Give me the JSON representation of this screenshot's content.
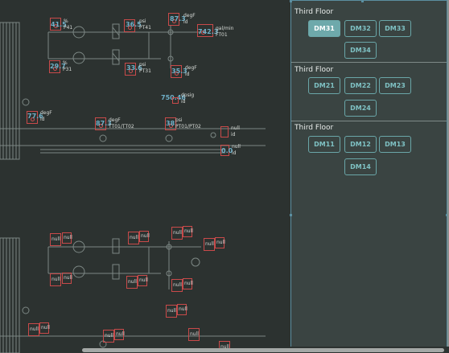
{
  "panel": {
    "sections": [
      {
        "title": "Third Floor",
        "buttons": [
          "DM31",
          "DM32",
          "DM33",
          "DM34"
        ],
        "active": "DM31"
      },
      {
        "title": "Third Floor",
        "buttons": [
          "DM21",
          "DM22",
          "DM23",
          "DM24"
        ]
      },
      {
        "title": "Third Floor",
        "buttons": [
          "DM11",
          "DM12",
          "DM13",
          "DM14"
        ]
      }
    ]
  },
  "schematic": {
    "readings": [
      {
        "value": "41.5",
        "unit": "%",
        "id": "P41"
      },
      {
        "value": "36.5",
        "unit": "psi",
        "id": "PT41"
      },
      {
        "value": "87.3",
        "unit": "degF",
        "id": "id"
      },
      {
        "value": "742.3",
        "unit": "gal/min",
        "id": "FT01"
      },
      {
        "value": "29.7",
        "unit": "%",
        "id": "P31"
      },
      {
        "value": "33.6",
        "unit": "psi",
        "id": "PT31"
      },
      {
        "value": "35.3",
        "unit": "degF",
        "id": "id"
      },
      {
        "value": "750.46",
        "unit": "dpsig",
        "id": "id"
      },
      {
        "value": "77.6",
        "unit": "degF",
        "id": "id"
      },
      {
        "value": "87.3",
        "unit": "degF",
        "id": "TT01/TT02"
      },
      {
        "value": "38",
        "unit": "psi",
        "id": "PT01/PT02"
      },
      {
        "value": "",
        "unit": "null",
        "id": "id"
      },
      {
        "value": "0.0",
        "unit": "null",
        "id": "id"
      }
    ],
    "null_text": "null"
  },
  "colors": {
    "background": "#2c3230",
    "panel": "#3a4442",
    "accent": "#6ea9ab",
    "alarm": "#c94a4a",
    "value": "#6fb0c8"
  }
}
